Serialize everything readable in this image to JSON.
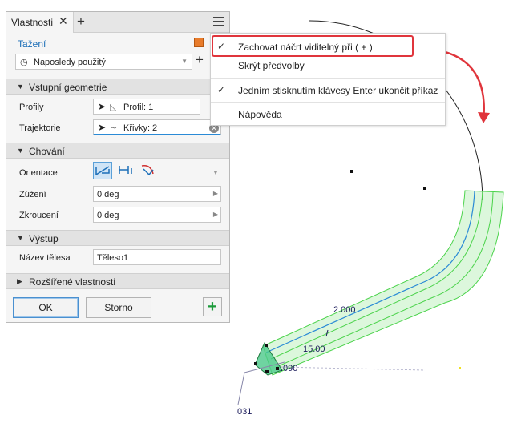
{
  "panel": {
    "tab_title": "Vlastnosti",
    "tab_close": "✕",
    "tab_add": "+",
    "command_name": "Tažení",
    "preset_value": "Naposledy použitý",
    "preset_add": "+",
    "sections": {
      "input_geometry": "Vstupní geometrie",
      "behavior": "Chování",
      "output": "Výstup",
      "advanced": "Rozšířené vlastnosti"
    },
    "profiles": {
      "label": "Profily",
      "value": "Profil: 1"
    },
    "path": {
      "label": "Trajektorie",
      "value": "Křivky: 2"
    },
    "orientation": {
      "label": "Orientace"
    },
    "taper": {
      "label": "Zúžení",
      "value": "0 deg"
    },
    "twist": {
      "label": "Zkroucení",
      "value": "0 deg"
    },
    "body_name": {
      "label": "Název tělesa",
      "value": "Těleso1"
    },
    "ok_label": "OK",
    "cancel_label": "Storno",
    "plus_label": "+"
  },
  "context_menu": {
    "items": [
      {
        "label": "Zachovat náčrt viditelný při ( + )",
        "checked": true,
        "highlighted": true
      },
      {
        "label": "Skrýt předvolby",
        "checked": false
      },
      {
        "label": "Jedním stisknutím klávesy Enter ukončit příkaz",
        "checked": true
      },
      {
        "label": "Nápověda",
        "checked": false
      }
    ],
    "check_glyph": "✓"
  },
  "viewport": {
    "dimensions": [
      ".090",
      "15.00",
      "2.000",
      ".031"
    ]
  },
  "colors": {
    "accent": "#2a8ad6",
    "highlight": "#e0353c",
    "preview_fill": "#9ee6a0",
    "path_line": "#2a8ad6"
  }
}
